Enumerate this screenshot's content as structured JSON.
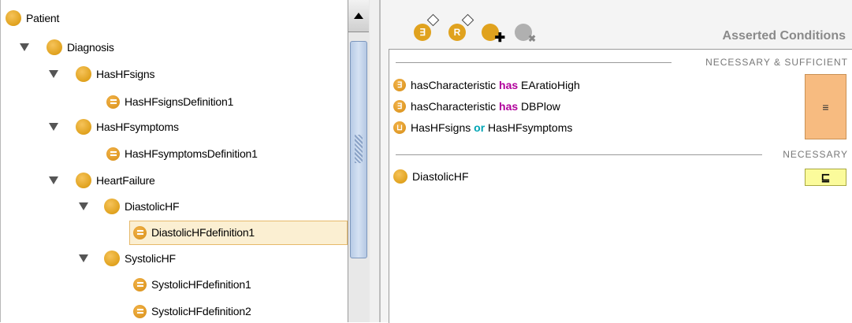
{
  "tree": {
    "items": [
      {
        "label": "Patient",
        "kind": "class"
      },
      {
        "label": "Diagnosis",
        "kind": "class",
        "expanded": true
      },
      {
        "label": "HasHFsigns",
        "kind": "class",
        "expanded": true
      },
      {
        "label": "HasHFsignsDefinition1",
        "kind": "definition"
      },
      {
        "label": "HasHFsymptoms",
        "kind": "class",
        "expanded": true
      },
      {
        "label": "HasHFsymptomsDefinition1",
        "kind": "definition"
      },
      {
        "label": "HeartFailure",
        "kind": "class",
        "expanded": true
      },
      {
        "label": "DiastolicHF",
        "kind": "class",
        "expanded": true
      },
      {
        "label": "DiastolicHFdefinition1",
        "kind": "definition",
        "selected": true
      },
      {
        "label": "SystolicHF",
        "kind": "class",
        "expanded": true
      },
      {
        "label": "SystolicHFdefinition1",
        "kind": "definition"
      },
      {
        "label": "SystolicHFdefinition2",
        "kind": "definition"
      }
    ]
  },
  "conditions": {
    "title": "Asserted Conditions",
    "toolbar_icons": [
      "create-restriction-icon",
      "create-anonymous-class-icon",
      "add-named-class-icon",
      "remove-class-icon"
    ],
    "necessary_sufficient_header": "NECESSARY & SUFFICIENT",
    "necessary_header": "NECESSARY",
    "equivalent_symbol": "≡",
    "subclass_symbol": "⊑",
    "rows": [
      {
        "icon": "∃",
        "pre": "hasCharacteristic ",
        "kw": "has",
        "post": " EAratioHigh"
      },
      {
        "icon": "∃",
        "pre": "hasCharacteristic ",
        "kw": "has",
        "post": " DBPlow"
      },
      {
        "icon": "⊔",
        "pre": "HasHFsigns ",
        "kw": "or",
        "post": " HasHFsymptoms"
      }
    ],
    "necessary_rows": [
      {
        "label": "DiastolicHF"
      }
    ]
  },
  "colors": {
    "class_orange": "#e0a21e",
    "has_keyword": "#b1009b",
    "or_keyword": "#00a5b5",
    "equivalent_box": "#f7bb80",
    "subclass_box": "#fbfb9b"
  }
}
